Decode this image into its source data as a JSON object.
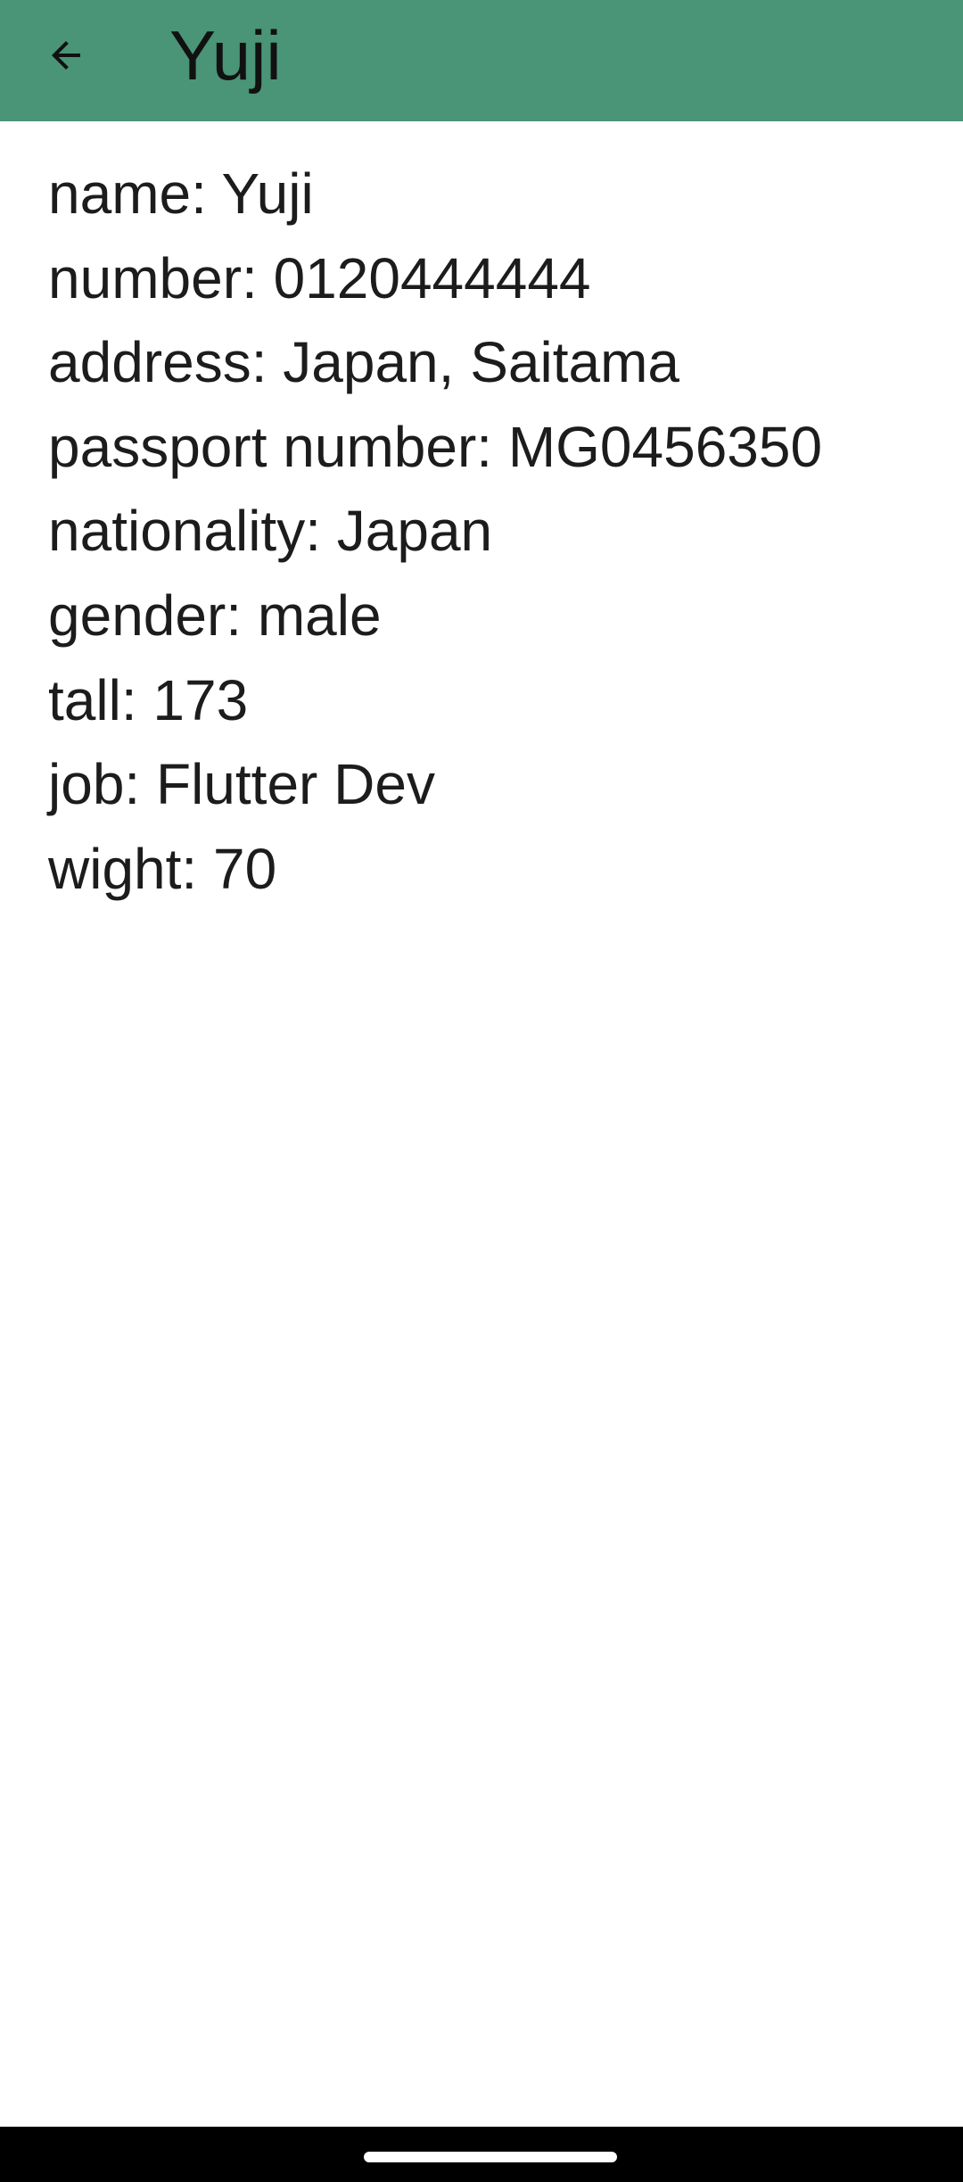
{
  "app_bar": {
    "title": "Yuji",
    "back_icon": "arrow-back-icon",
    "background": "#4a9478"
  },
  "details": [
    "name: Yuji",
    "number: 0120444444",
    "address: Japan, Saitama",
    "passport number: MG0456350",
    "nationality: Japan",
    "gender: male",
    "tall: 173",
    "job: Flutter Dev",
    "wight: 70"
  ]
}
